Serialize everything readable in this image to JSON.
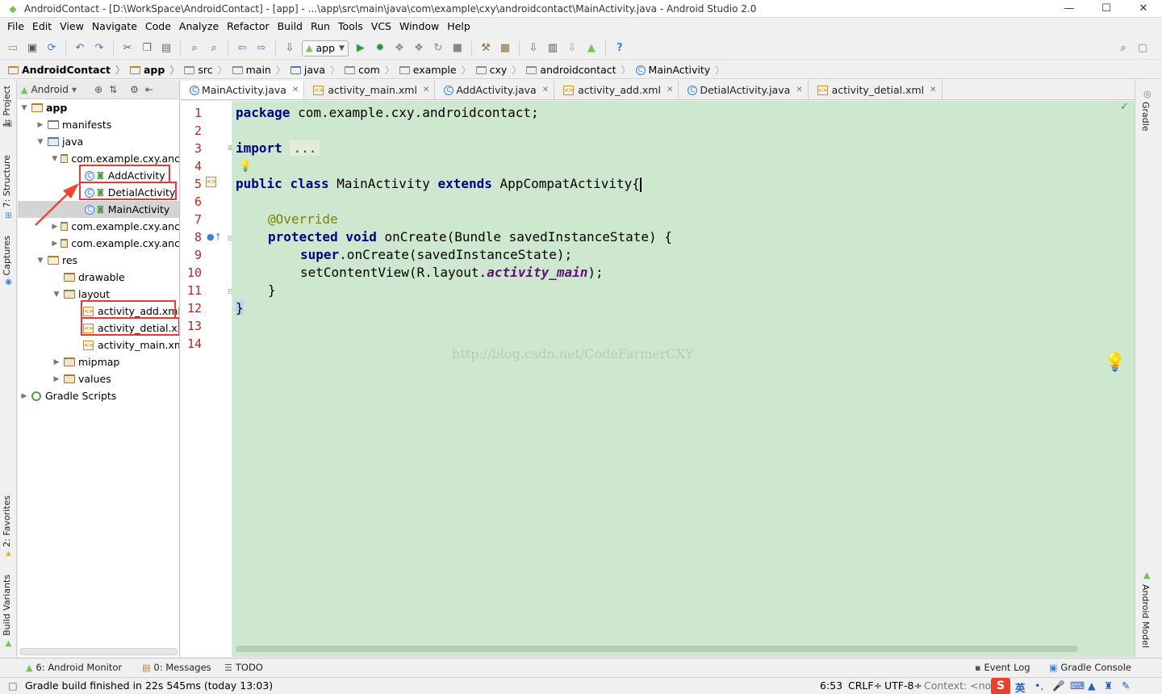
{
  "window": {
    "title": "AndroidContact - [D:\\WorkSpace\\AndroidContact] - [app] - ...\\app\\src\\main\\java\\com\\example\\cxy\\androidcontact\\MainActivity.java - Android Studio 2.0",
    "minimize": "—",
    "maximize": "☐",
    "close": "✕"
  },
  "menu": [
    "File",
    "Edit",
    "View",
    "Navigate",
    "Code",
    "Analyze",
    "Refactor",
    "Build",
    "Run",
    "Tools",
    "VCS",
    "Window",
    "Help"
  ],
  "toolbar": {
    "run_config": "app"
  },
  "breadcrumb": [
    "AndroidContact",
    "app",
    "src",
    "main",
    "java",
    "com",
    "example",
    "cxy",
    "androidcontact",
    "MainActivity"
  ],
  "left_strip": {
    "project": "1: Project",
    "structure": "7: Structure",
    "captures": "Captures",
    "favorites": "2: Favorites",
    "build_variants": "Build Variants"
  },
  "right_strip": {
    "gradle": "Gradle",
    "android_model": "Android Model"
  },
  "project_panel": {
    "view_mode": "Android",
    "tree": [
      "app",
      "manifests",
      "java",
      "com.example.cxy.anc",
      "AddActivity",
      "DetialActivity",
      "MainActivity",
      "com.example.cxy.anc",
      "com.example.cxy.anc",
      "res",
      "drawable",
      "layout",
      "activity_add.xml",
      "activity_detial.xml",
      "activity_main.xml",
      "mipmap",
      "values",
      "Gradle Scripts"
    ]
  },
  "tabs": [
    "MainActivity.java",
    "activity_main.xml",
    "AddActivity.java",
    "activity_add.xml",
    "DetialActivity.java",
    "activity_detial.xml"
  ],
  "editor": {
    "line_numbers": [
      "1",
      "2",
      "3",
      "4",
      "5",
      "6",
      "7",
      "8",
      "9",
      "10",
      "11",
      "12",
      "13",
      "14"
    ],
    "code": {
      "l1_kw": "package",
      "l1_rest": " com.example.cxy.androidcontact;",
      "l3_kw": "import",
      "l3_fold": "...",
      "l6_kw1": "public",
      "l6_kw2": "class",
      "l6_name": " MainActivity ",
      "l6_kw3": "extends",
      "l6_rest": " AppCompatActivity{",
      "l8_ann": "@Override",
      "l9_kw1": "protected",
      "l9_kw2": "void",
      "l9_rest": " onCreate(Bundle savedInstanceState) {",
      "l10_kw": "super",
      "l10_rest": ".onCreate(savedInstanceState);",
      "l11_a": "setContentView(R.layout.",
      "l11_itf": "activity_main",
      "l11_b": ");",
      "l12": "}",
      "l13": "}"
    },
    "watermark": "http://blog.csdn.net/CodeFarmerCXY"
  },
  "bottom_tools": {
    "android_monitor": "6: Android Monitor",
    "messages": "0: Messages",
    "todo": "TODO",
    "event_log": "Event Log",
    "gradle_console": "Gradle Console"
  },
  "status": {
    "message": "Gradle build finished in 22s 545ms (today 13:03)",
    "position": "6:53",
    "line_sep": "CRLF÷",
    "encoding": "UTF-8÷",
    "context": "Context: <no c",
    "ime": "英"
  },
  "colors": {
    "editor_bg": "#cde8cf",
    "line_number": "#b22a1f",
    "keyword": "#000080",
    "annotation": "#808000",
    "highlight_box": "#e53935"
  }
}
